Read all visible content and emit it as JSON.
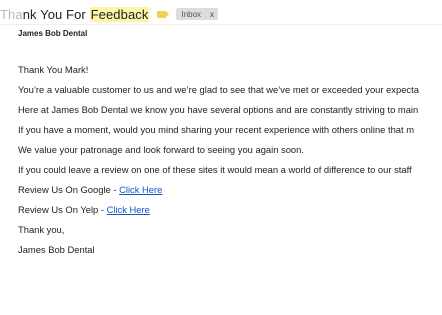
{
  "email": {
    "subject_faded": "Tha",
    "subject_main": "nk You For ",
    "subject_highlight": "Feedback",
    "label_icon": "label-tag-icon",
    "inbox_badge": "Inbox",
    "inbox_badge_close": "x",
    "sender": "James Bob Dental"
  },
  "body": {
    "greeting": "Thank You Mark!",
    "para1": "You’re a valuable customer to us and we’re glad to see that we’ve met or exceeded your expecta",
    "para2": "Here at James Bob Dental we know you have several options and are constantly striving to main",
    "para3": "If you have a moment, would you mind sharing your recent experience with others online that m",
    "para4": "We value your patronage and look  forward to seeing you again soon.",
    "para5": "If you could leave a review on one of these sites it would mean a world of difference to our staff",
    "google_label": "Review Us On Google - ",
    "google_link": "Click Here",
    "yelp_label": "Review Us On Yelp - ",
    "yelp_link": "Click Here",
    "closing": "Thank you,",
    "signature": "James Bob Dental"
  },
  "colors": {
    "highlight": "#fdf5a6",
    "label": "#f0d34e",
    "link": "#1155cc"
  }
}
